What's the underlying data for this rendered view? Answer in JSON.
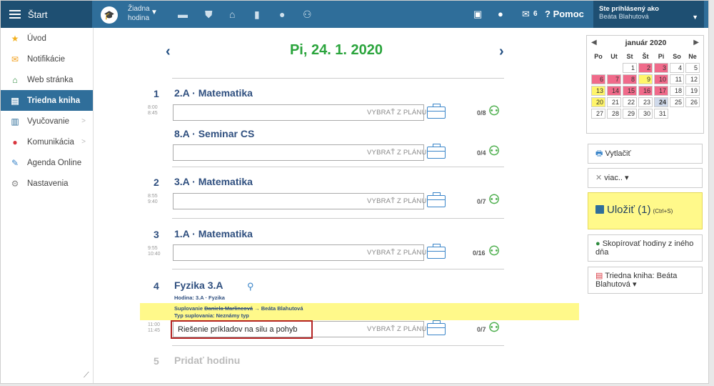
{
  "topbar": {
    "start_label": "Štart",
    "hodina_line1": "Žiadna",
    "hodina_line2": "hodina",
    "messages_count": "6",
    "help_label": "Pomoc",
    "user_line1": "Ste prihlásený ako",
    "user_line2": "Beáta Blahutová"
  },
  "sidebar": {
    "items": [
      {
        "label": "Úvod",
        "icon": "star-icon"
      },
      {
        "label": "Notifikácie",
        "icon": "envelope-icon"
      },
      {
        "label": "Web stránka",
        "icon": "home-icon"
      },
      {
        "label": "Triedna kniha",
        "icon": "book-icon"
      },
      {
        "label": "Vyučovanie",
        "icon": "open-book-icon"
      },
      {
        "label": "Komunikácia",
        "icon": "chat-icon"
      },
      {
        "label": "Agenda Online",
        "icon": "pen-icon"
      },
      {
        "label": "Nastavenia",
        "icon": "gear-icon"
      }
    ]
  },
  "main": {
    "date": "Pi, 24. 1. 2020",
    "pick_label": "VYBRAŤ Z PLÁNU",
    "lessons": [
      {
        "num": "1",
        "time_from": "8:00",
        "time_to": "8:45",
        "title": "2.A · Matematika",
        "count": "0/8",
        "value": ""
      },
      {
        "num": "",
        "time_from": "",
        "time_to": "",
        "title": "8.A · Seminar CS",
        "count": "0/4",
        "value": ""
      },
      {
        "num": "2",
        "time_from": "8:55",
        "time_to": "9:40",
        "title": "3.A · Matematika",
        "count": "0/7",
        "value": ""
      },
      {
        "num": "3",
        "time_from": "9:55",
        "time_to": "10:40",
        "title": "1.A · Matematika",
        "count": "0/16",
        "value": ""
      },
      {
        "num": "4",
        "time_from": "11:00",
        "time_to": "11:45",
        "title": "Fyzika 3.A",
        "count": "0/7",
        "value": "Riešenie príkladov na silu a pohyb"
      }
    ],
    "lesson4_info": {
      "hodina": "Hodina: 3.A · Fyzika",
      "suplovanie_prefix": "Suplovanie",
      "suplovanie_from": "Daniela Marlincová",
      "suplovanie_to": "→ Beáta Blahutová",
      "typ": "Typ suplovania:  Neznámy typ"
    },
    "add_num": "5",
    "add_label": "Pridať hodinu"
  },
  "calendar": {
    "month": "január 2020",
    "weekdays": [
      "Po",
      "Ut",
      "St",
      "Št",
      "Pi",
      "So",
      "Ne"
    ]
  },
  "actions": {
    "print": "Vytlačiť",
    "more": "viac.. ▾",
    "save": "Uložiť (1)",
    "save_hint": "(Ctrl+S)",
    "copy": "Skopírovať hodiny z iného dňa",
    "classbook": "Triedna kniha: Beáta Blahutová ▾"
  }
}
